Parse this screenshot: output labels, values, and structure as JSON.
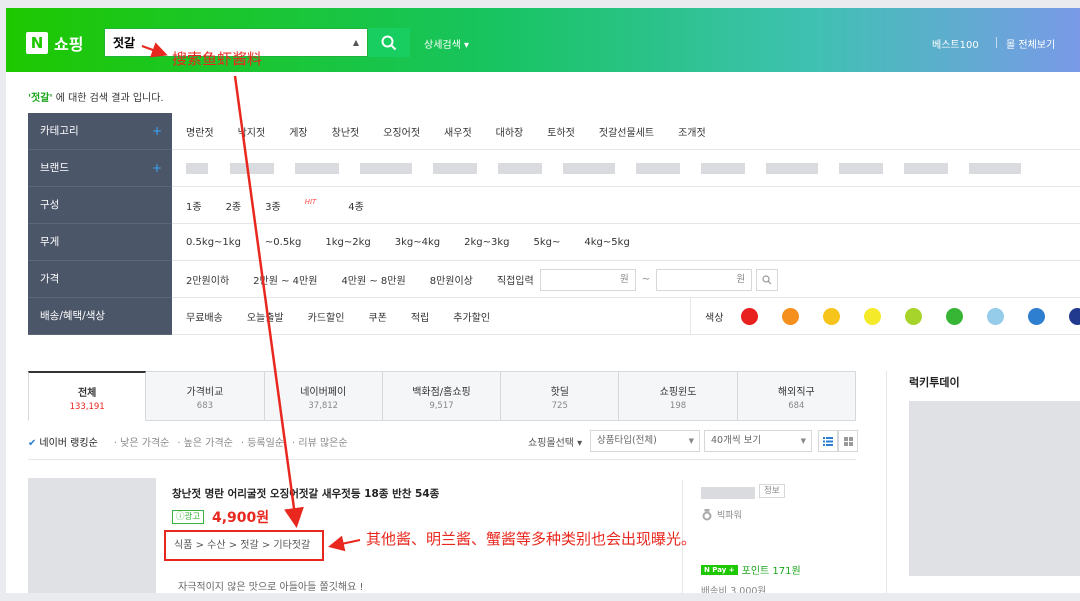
{
  "header": {
    "logo_n": "N",
    "logo_text": "쇼핑",
    "search_value": "젓갈",
    "detail_search": "상세검색 ▾",
    "best100": "베스트100",
    "mall_all": "몰 전체보기"
  },
  "annotations": {
    "search_note": "搜索鱼虾酱料",
    "category_note": "其他酱、明兰酱、蟹酱等多种类别也会出现曝光。"
  },
  "result": {
    "keyword": "'젓갈'",
    "message": " 에 대한 검색 결과 입니다."
  },
  "filters": {
    "category_label": "카테고리",
    "categories": [
      "명란젓",
      "낙지젓",
      "게장",
      "창난젓",
      "오징어젓",
      "새우젓",
      "대하장",
      "토하젓",
      "젓갈선물세트",
      "조개젓"
    ],
    "brand_label": "브랜드",
    "composition_label": "구성",
    "compositions": [
      "1종",
      "2종",
      "3종",
      "4종"
    ],
    "hit": "HIT",
    "weight_label": "무게",
    "weights": [
      "0.5kg~1kg",
      "~0.5kg",
      "1kg~2kg",
      "3kg~4kg",
      "2kg~3kg",
      "5kg~",
      "4kg~5kg"
    ],
    "price_label": "가격",
    "prices": [
      "2만원이하",
      "2만원 ~ 4만원",
      "4만원 ~ 8만원",
      "8만원이상"
    ],
    "direct_input": "직접입력",
    "won": "원",
    "tilde": "~",
    "shipping_label": "배송/혜택/색상",
    "benefits": [
      "무료배송",
      "오늘출발",
      "카드할인",
      "쿠폰",
      "적립",
      "추가할인"
    ],
    "color_label": "색상",
    "colors": [
      "#e8201e",
      "#f5901e",
      "#f7c41c",
      "#f4ea2a",
      "#a7d42a",
      "#37b534",
      "#94cce9",
      "#2f7fd1",
      "#223a8e",
      "#ffffff",
      "#c4c4c4",
      "#151515",
      "#7b8a3a",
      "#8a5a2e",
      "#8e3aa8",
      "#c03ac8"
    ]
  },
  "tabs": [
    {
      "label": "전체",
      "count": "133,191"
    },
    {
      "label": "가격비교",
      "count": "683"
    },
    {
      "label": "네이버페이",
      "count": "37,812"
    },
    {
      "label": "백화점/홈쇼핑",
      "count": "9,517"
    },
    {
      "label": "핫딜",
      "count": "725"
    },
    {
      "label": "쇼핑윈도",
      "count": "198"
    },
    {
      "label": "해외직구",
      "count": "684"
    }
  ],
  "sort": {
    "options": [
      "네이버 랭킹순",
      "· 낮은 가격순",
      "· 높은 가격순",
      "· 등록일순",
      "· 리뷰 많은순"
    ],
    "mall_select": "쇼핑몰선택 ▾",
    "product_type": "상품타입(전체)",
    "per_page": "40개씩 보기"
  },
  "product": {
    "title": "창난젓 명란 어리굴젓 오징어젓갈 새우젓등 18종 반찬 54종",
    "ad": "ⓘ광고",
    "price": "4,900원",
    "category_path": "식품 > 수산 > 젓갈 > 기타젓갈",
    "description": "자극적이지 않은 맛으로 아들아들 쫄깃해요 !",
    "seller_info": "정보",
    "seller_grade": "빅파워",
    "npay": "N Pay +",
    "points": "포인트 171원",
    "shipping": "배송비 3,000원"
  },
  "side": {
    "lucky_today": "럭키투데이"
  }
}
